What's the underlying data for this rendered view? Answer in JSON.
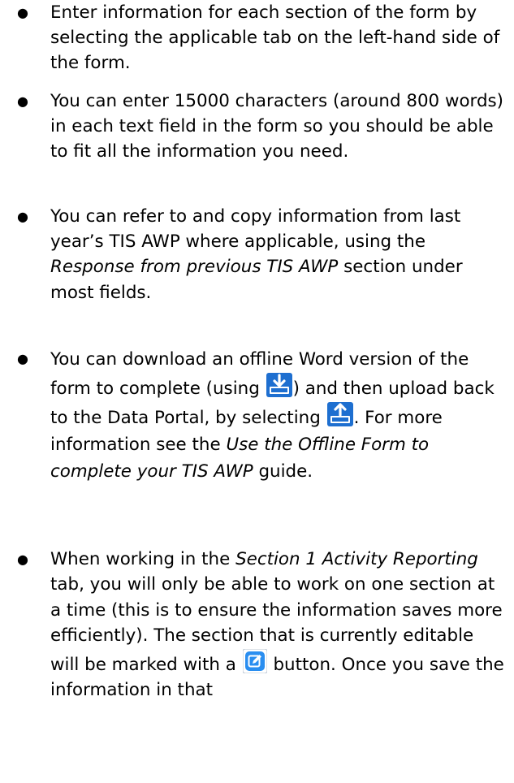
{
  "bullets": [
    {
      "text": "Enter information for each section of the form by selecting the applicable tab on the left-hand side of the form."
    },
    {
      "text": "You can enter 15000 characters (around 800 words) in each text field in the form so you should be able to fit all the information you need."
    },
    {
      "pre": "You can refer to and copy information from last year’s TIS AWP where applicable, using the ",
      "italic": "Response from previous TIS AWP",
      "post": " section under most fields."
    },
    {
      "a": "You can download an offline Word version of the form to complete (using ",
      "b": ") and then upload back to the Data Portal, by selecting ",
      "c": ". For more information see the ",
      "italic": "Use the Offline Form to complete your TIS AWP",
      "d": " guide."
    },
    {
      "pre": "When working in the ",
      "italic": "Section 1 Activity Reporting",
      "post": " tab, you will only be able to work on one section at a time (this is to ensure the information saves more efficiently). The section that is currently editable will be marked with a ",
      "after_icon": " button. Once you save the information in that"
    }
  ],
  "icons": {
    "download": "download-icon",
    "upload": "upload-icon",
    "edit": "edit-icon"
  },
  "colors": {
    "icon_blue": "#1e6fd0",
    "edit_blue": "#2a8ef0"
  }
}
